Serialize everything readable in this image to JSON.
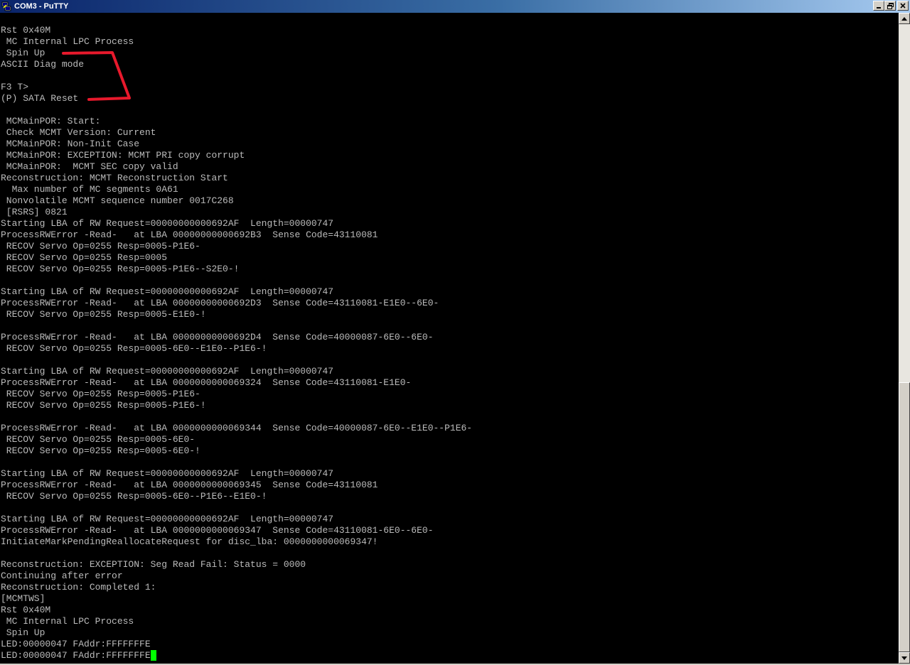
{
  "window": {
    "title": "COM3 - PuTTY",
    "icon": "putty-icon",
    "controls": {
      "minimize_icon": "minimize-icon",
      "maximize_icon": "restore-icon",
      "close_icon": "close-icon"
    }
  },
  "colors": {
    "terminal_bg": "#000000",
    "terminal_fg": "#bbbbbb",
    "cursor": "#00ff00",
    "annotation": "#e8192c",
    "titlebar_start": "#0a246a",
    "titlebar_end": "#a6caf0"
  },
  "terminal": {
    "lines": [
      "Rst 0x40M",
      " MC Internal LPC Process",
      " Spin Up",
      "ASCII Diag mode",
      "",
      "F3 T>",
      "(P) SATA Reset",
      "",
      " MCMainPOR: Start:",
      " Check MCMT Version: Current",
      " MCMainPOR: Non-Init Case",
      " MCMainPOR: EXCEPTION: MCMT PRI copy corrupt",
      " MCMainPOR:  MCMT SEC copy valid",
      "Reconstruction: MCMT Reconstruction Start",
      "  Max number of MC segments 0A61",
      " Nonvolatile MCMT sequence number 0017C268",
      " [RSRS] 0821",
      "Starting LBA of RW Request=00000000000692AF  Length=00000747",
      "ProcessRWError -Read-   at LBA 00000000000692B3  Sense Code=43110081",
      " RECOV Servo Op=0255 Resp=0005-P1E6-",
      " RECOV Servo Op=0255 Resp=0005",
      " RECOV Servo Op=0255 Resp=0005-P1E6--S2E0-!",
      "",
      "Starting LBA of RW Request=00000000000692AF  Length=00000747",
      "ProcessRWError -Read-   at LBA 00000000000692D3  Sense Code=43110081-E1E0--6E0-",
      " RECOV Servo Op=0255 Resp=0005-E1E0-!",
      "",
      "ProcessRWError -Read-   at LBA 00000000000692D4  Sense Code=40000087-6E0--6E0-",
      " RECOV Servo Op=0255 Resp=0005-6E0--E1E0--P1E6-!",
      "",
      "Starting LBA of RW Request=00000000000692AF  Length=00000747",
      "ProcessRWError -Read-   at LBA 0000000000069324  Sense Code=43110081-E1E0-",
      " RECOV Servo Op=0255 Resp=0005-P1E6-",
      " RECOV Servo Op=0255 Resp=0005-P1E6-!",
      "",
      "ProcessRWError -Read-   at LBA 0000000000069344  Sense Code=40000087-6E0--E1E0--P1E6-",
      " RECOV Servo Op=0255 Resp=0005-6E0-",
      " RECOV Servo Op=0255 Resp=0005-6E0-!",
      "",
      "Starting LBA of RW Request=00000000000692AF  Length=00000747",
      "ProcessRWError -Read-   at LBA 0000000000069345  Sense Code=43110081",
      " RECOV Servo Op=0255 Resp=0005-6E0--P1E6--E1E0-!",
      "",
      "Starting LBA of RW Request=00000000000692AF  Length=00000747",
      "ProcessRWError -Read-   at LBA 0000000000069347  Sense Code=43110081-6E0--6E0-",
      "InitiateMarkPendingReallocateRequest for disc_lba: 0000000000069347!",
      "",
      "Reconstruction: EXCEPTION: Seg Read Fail: Status = 0000",
      "Continuing after error",
      "Reconstruction: Completed 1:",
      "[MCMTWS]",
      "Rst 0x40M",
      " MC Internal LPC Process",
      " Spin Up",
      "LED:00000047 FAddr:FFFFFFFE",
      "LED:00000047 FAddr:FFFFFFFE"
    ]
  },
  "scrollbar": {
    "up_icon": "scroll-up-arrow-icon",
    "down_icon": "scroll-down-arrow-icon"
  }
}
